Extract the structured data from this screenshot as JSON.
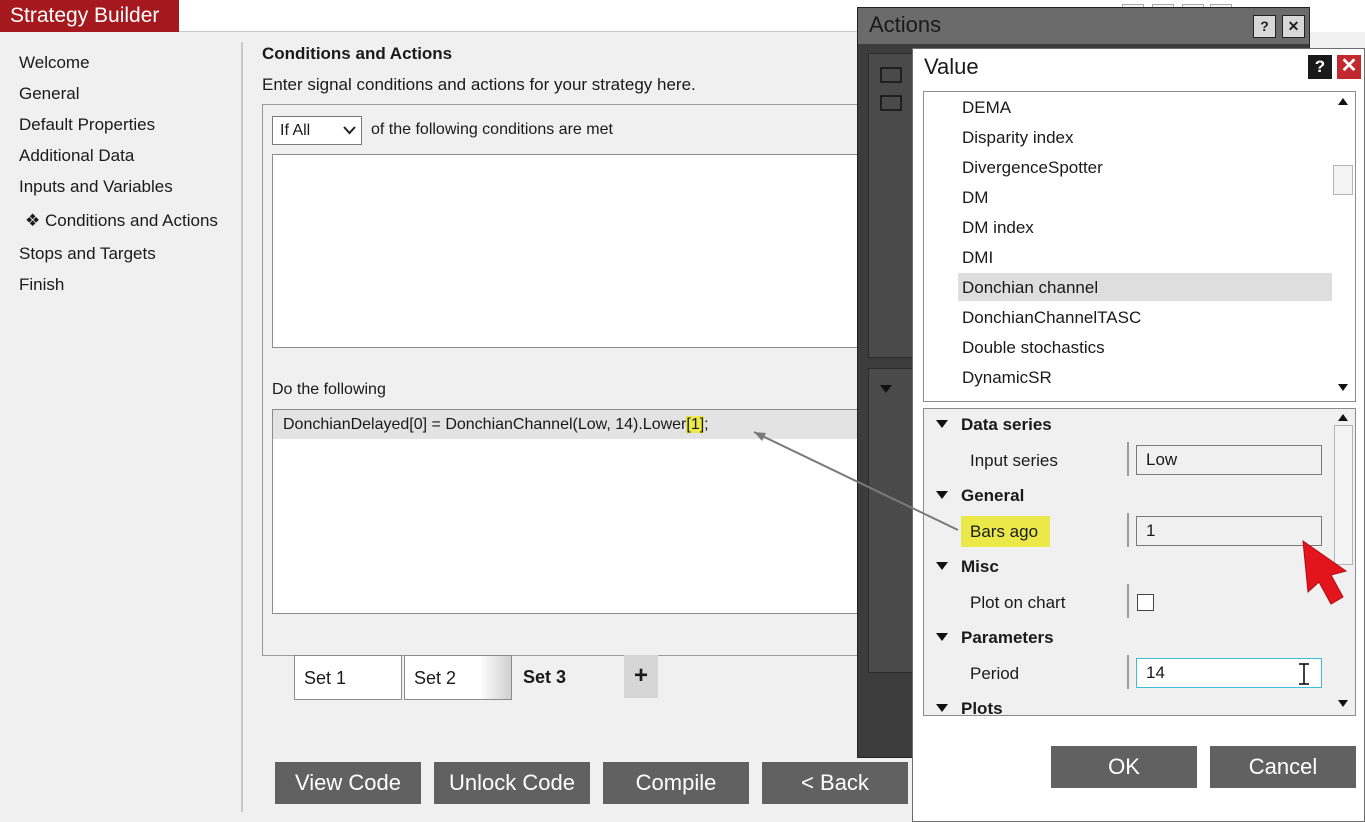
{
  "strategy_builder": {
    "title": "Strategy Builder",
    "nav": [
      {
        "label": "Welcome"
      },
      {
        "label": "General"
      },
      {
        "label": "Default Properties"
      },
      {
        "label": "Additional Data"
      },
      {
        "label": "Inputs and Variables"
      },
      {
        "label": "❖ Conditions and Actions",
        "active": true
      },
      {
        "label": "Stops and Targets"
      },
      {
        "label": "Finish"
      }
    ],
    "section_title": "Conditions and Actions",
    "section_subtitle": "Enter signal conditions and actions for your strategy here.",
    "condition_mode": "If All",
    "condition_text": "of the following conditions are met",
    "do_following": "Do the following",
    "action_code_pre": "DonchianDelayed[0] = DonchianChannel(Low, 14).Lower",
    "action_code_hl": "[1]",
    "action_code_post": ";",
    "tabs": [
      {
        "label": "Set 1"
      },
      {
        "label": "Set 2"
      },
      {
        "label": "Set 3",
        "active": true
      }
    ],
    "add_tab": "+",
    "buttons": {
      "view_code": "View Code",
      "unlock_code": "Unlock Code",
      "compile": "Compile",
      "back": "< Back"
    }
  },
  "actions_dialog": {
    "title": "Actions",
    "help": "?",
    "close": "✕"
  },
  "value_dialog": {
    "title": "Value",
    "help": "?",
    "close": "✕",
    "indicators": [
      "DEMA",
      "Disparity index",
      "DivergenceSpotter",
      "DM",
      "DM index",
      "DMI",
      "Donchian channel",
      "DonchianChannelTASC",
      "Double stochastics",
      "DynamicSR"
    ],
    "selected_indicator": "Donchian channel",
    "properties": {
      "data_series": {
        "category": "Data series",
        "input_series_label": "Input series",
        "input_series_value": "Low"
      },
      "general": {
        "category": "General",
        "bars_ago_label": "Bars ago",
        "bars_ago_value": "1"
      },
      "misc": {
        "category": "Misc",
        "plot_on_chart_label": "Plot on chart",
        "plot_on_chart_checked": false
      },
      "parameters": {
        "category": "Parameters",
        "period_label": "Period",
        "period_value": "14"
      },
      "plots": {
        "category": "Plots"
      }
    },
    "ok_label": "OK",
    "cancel_label": "Cancel"
  },
  "colors": {
    "title_red": "#a5191e",
    "button_gray": "#616161",
    "highlight_yellow": "#ebe94a",
    "arrow_red": "#e3141c",
    "accent_blue": "#1e86e0"
  }
}
